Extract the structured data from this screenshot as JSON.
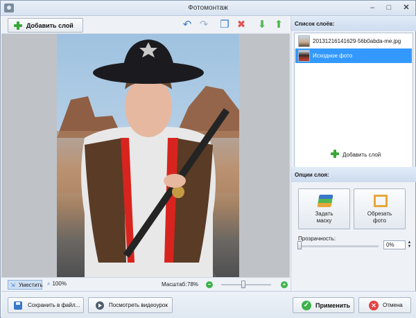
{
  "window": {
    "title": "Фотомонтаж",
    "minimize_glyph": "–",
    "maximize_glyph": "□",
    "close_glyph": "✕"
  },
  "toolbar": {
    "add_layer_label": "Добавить слой",
    "icons": [
      "undo-icon",
      "redo-icon",
      "copy-icon",
      "delete-icon",
      "move-down-icon",
      "move-up-icon"
    ],
    "glyphs": {
      "undo": "↶",
      "redo": "↷",
      "copy": "❐",
      "delete": "✖",
      "down": "⬇",
      "up": "⬆"
    }
  },
  "statusbar": {
    "fit_label": "Уместить",
    "actual_size_label": "100%",
    "scale_label": "Масштаб:",
    "scale_value": "78%",
    "zoom_minus": "−",
    "zoom_plus": "+",
    "zoom_level": 0.45
  },
  "layers": {
    "header": "Список слоёв:",
    "items": [
      {
        "label": "20131216141629-56b0abda-me.jpg",
        "selected": false
      },
      {
        "label": "Исходное фото",
        "selected": true
      }
    ],
    "add_layer_label": "Добавить слой"
  },
  "layer_options": {
    "header": "Опции слоя:",
    "mask_label_1": "Задать",
    "mask_label_2": "маску",
    "crop_label_1": "Обрезать",
    "crop_label_2": "фото",
    "opacity_label": "Прозрачность:",
    "opacity_value": "0%",
    "spin_up": "▲",
    "spin_down": "▼"
  },
  "footer": {
    "save_label": "Сохранить в файл...",
    "video_label": "Посмотреть видеоурок",
    "apply_label": "Применить",
    "apply_glyph": "✓",
    "cancel_label": "Отмена",
    "cancel_glyph": "✕"
  },
  "colors": {
    "selection": "#3399ff",
    "accent_green": "#3db24a",
    "accent_red": "#e34242",
    "hat": "#1b1b1f",
    "vest": "#5a3b26",
    "fringe": "#d8241e",
    "skin": "#e6b8a0",
    "plaid": "#e8e8e8"
  }
}
